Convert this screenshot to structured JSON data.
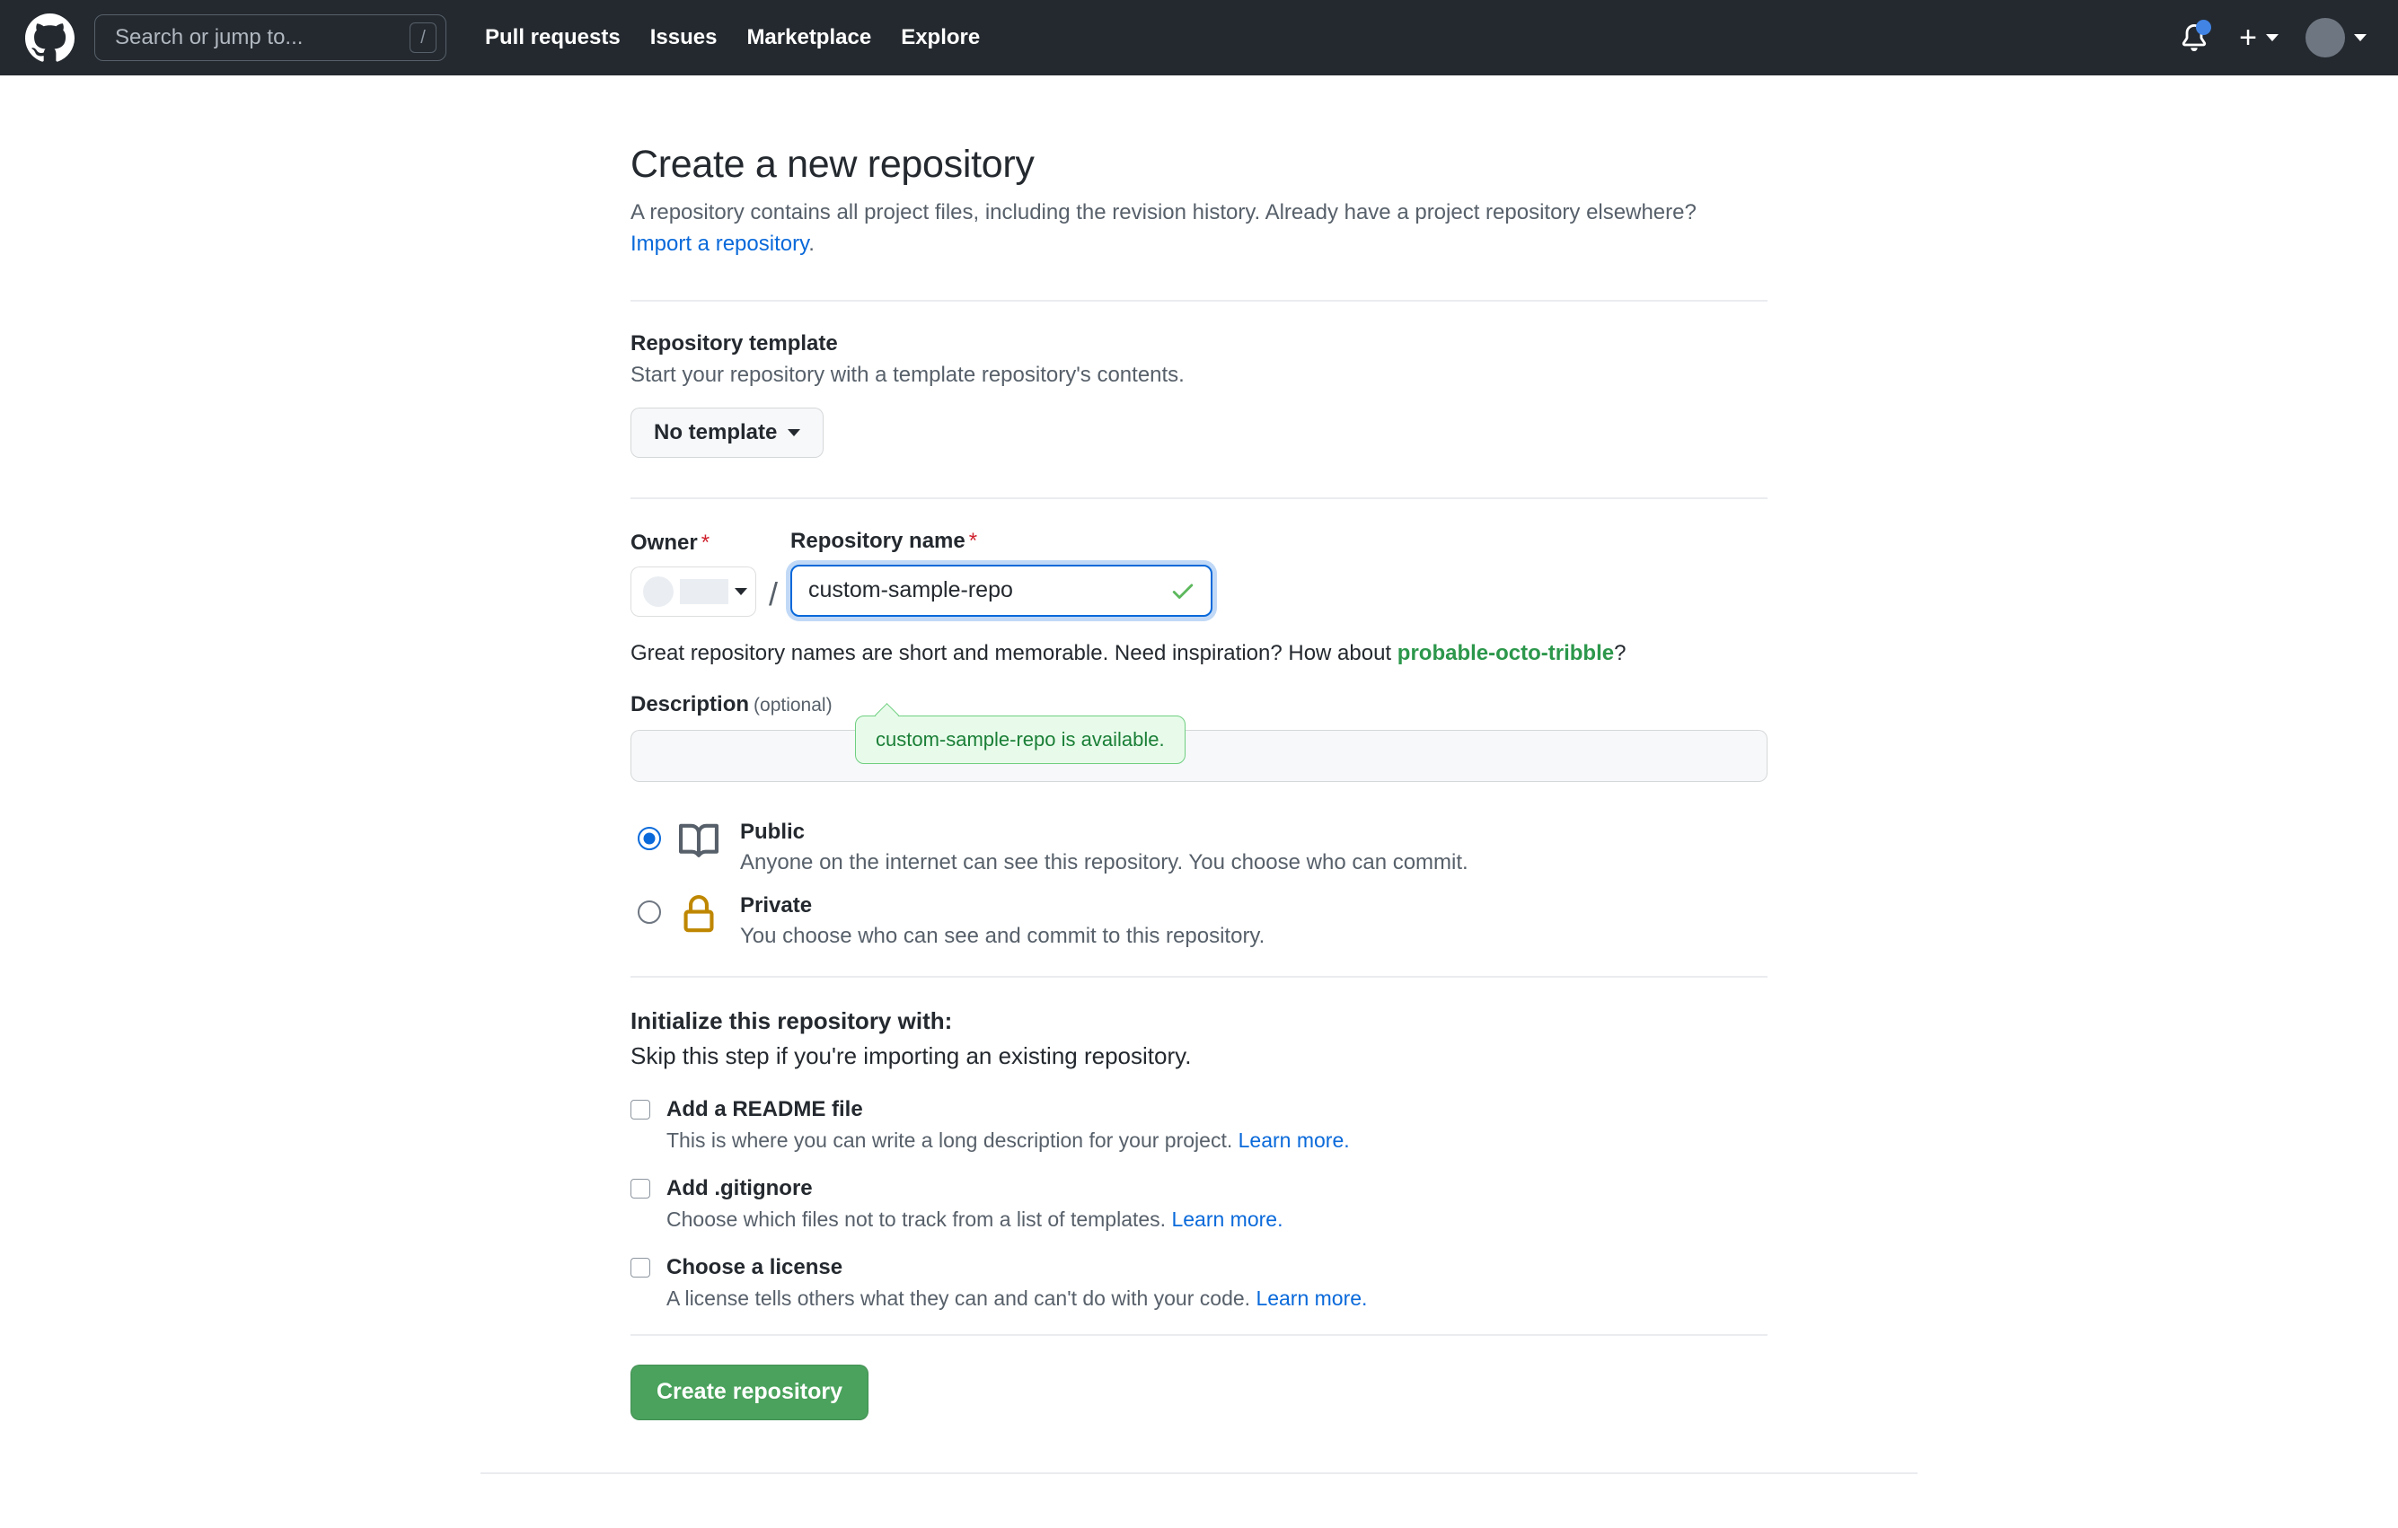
{
  "header": {
    "logo_name": "github-logo",
    "search": {
      "placeholder": "Search or jump to...",
      "shortcut": "/"
    },
    "nav": [
      {
        "label": "Pull requests"
      },
      {
        "label": "Issues"
      },
      {
        "label": "Marketplace"
      },
      {
        "label": "Explore"
      }
    ],
    "notifications_icon": "bell-icon",
    "create_new_icon": "plus-icon",
    "profile_icon": "avatar",
    "accent_dot_color": "#4184e4",
    "background_color": "#24292f"
  },
  "page": {
    "title": "Create a new repository",
    "lead_text": "A repository contains all project files, including the revision history. Already have a project repository elsewhere? ",
    "lead_link": "Import a repository",
    "lead_tail": "."
  },
  "template_section": {
    "title": "Repository template",
    "subtitle": "Start your repository with a template repository's contents.",
    "button_label": "No template"
  },
  "name_section": {
    "owner_label": "Owner",
    "owner_required": "*",
    "owner_value": "",
    "separator": "/",
    "repo_label": "Repository name",
    "repo_required": "*",
    "repo_value": "custom-sample-repo",
    "valid_icon": "check-icon",
    "tooltip": "custom-sample-repo is available.",
    "hint_prefix": "Great repository names are short and memorable. Need inspiration? How about ",
    "hint_suggestion": "probable-octo-tribble",
    "hint_suffix": "?",
    "suggestion_color": "#2c974b"
  },
  "description_section": {
    "label": "Description",
    "optional": "(optional)",
    "value": "",
    "placeholder": ""
  },
  "visibility": [
    {
      "id": "public",
      "icon": "repo-book-icon",
      "title": "Public",
      "description": "Anyone on the internet can see this repository. You choose who can commit.",
      "selected": true
    },
    {
      "id": "private",
      "icon": "lock-icon",
      "title": "Private",
      "description": "You choose who can see and commit to this repository.",
      "selected": false
    }
  ],
  "initialize": {
    "title": "Initialize this repository with:",
    "subtitle": "Skip this step if you're importing an existing repository.",
    "options": [
      {
        "label": "Add a README file",
        "description": "This is where you can write a long description for your project. ",
        "link": "Learn more.",
        "checked": false
      },
      {
        "label": "Add .gitignore",
        "description": "Choose which files not to track from a list of templates. ",
        "link": "Learn more.",
        "checked": false
      },
      {
        "label": "Choose a license",
        "description": "A license tells others what they can and can't do with your code. ",
        "link": "Learn more.",
        "checked": false
      }
    ]
  },
  "submit": {
    "label": "Create repository",
    "color": "#4aa25c"
  }
}
